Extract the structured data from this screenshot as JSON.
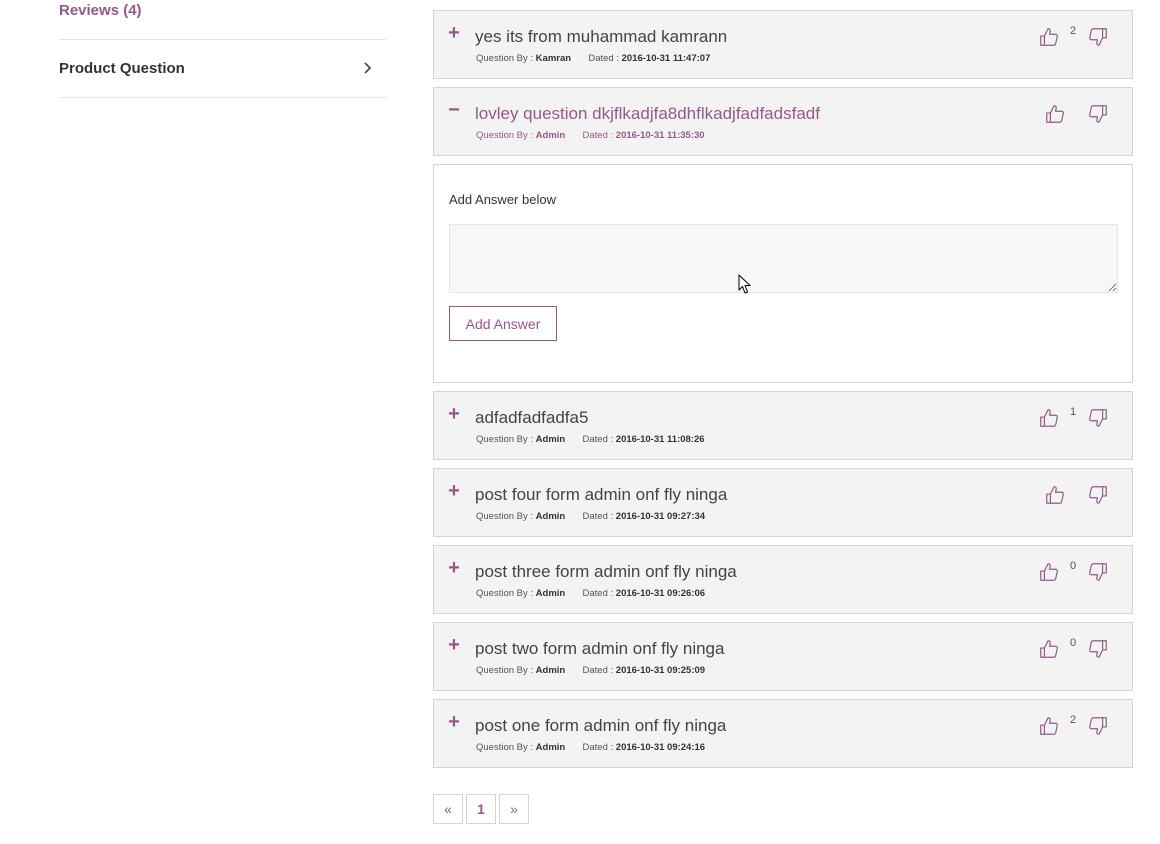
{
  "sidebar": {
    "reviews_label": "Reviews (4)",
    "question_label": "Product Question"
  },
  "labels": {
    "question_by": "Question By :",
    "dated": "Dated :"
  },
  "questions": [
    {
      "title": "yes its from muhammad kamrann",
      "author": "Kamran",
      "date": "2016-10-31 11:47:07",
      "votes": "2",
      "toggle": "+"
    },
    {
      "title": "lovley question dkjflkadjfa8dhflkadjfadfadsfadf",
      "author": "Admin",
      "date": "2016-10-31 11:35:30",
      "votes": "",
      "toggle": "−"
    },
    {
      "title": "adfadfadfadfa5",
      "author": "Admin",
      "date": "2016-10-31 11:08:26",
      "votes": "1",
      "toggle": "+"
    },
    {
      "title": "post four form admin onf fly ninga",
      "author": "Admin",
      "date": "2016-10-31 09:27:34",
      "votes": "",
      "toggle": "+"
    },
    {
      "title": "post three form admin onf fly ninga",
      "author": "Admin",
      "date": "2016-10-31 09:26:06",
      "votes": "0",
      "toggle": "+"
    },
    {
      "title": "post two form admin onf fly ninga",
      "author": "Admin",
      "date": "2016-10-31 09:25:09",
      "votes": "0",
      "toggle": "+"
    },
    {
      "title": "post one form admin onf fly ninga",
      "author": "Admin",
      "date": "2016-10-31 09:24:16",
      "votes": "2",
      "toggle": "+"
    }
  ],
  "answer": {
    "label": "Add Answer below",
    "value": "",
    "button_label": "Add Answer"
  },
  "pagination": {
    "prev": "«",
    "current": "1",
    "next": "»"
  },
  "colors": {
    "accent": "#96588a",
    "card_bg": "#f3f3f3",
    "border": "#d4d4d4"
  },
  "icons": {
    "upvote": "thumbs-up-icon",
    "downvote": "thumbs-down-icon",
    "chevron": "chevron-right-icon",
    "cursor": "mouse-pointer-icon"
  }
}
